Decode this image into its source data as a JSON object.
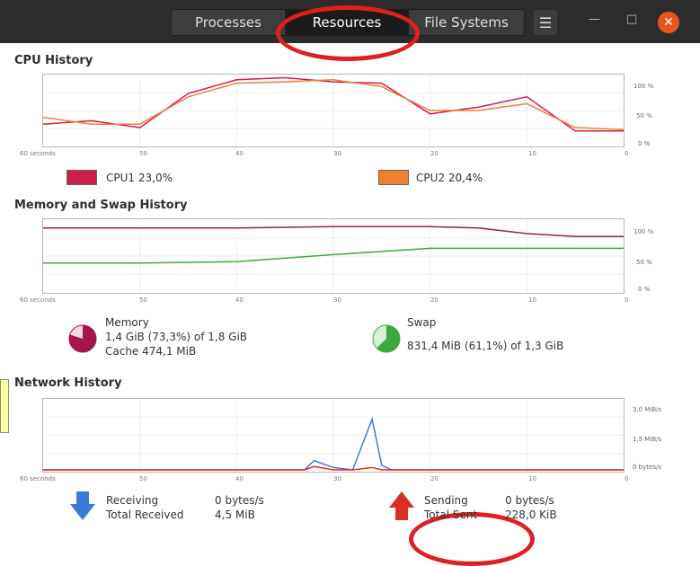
{
  "window": {
    "tabs": [
      {
        "label": "Processes"
      },
      {
        "label": "Resources"
      },
      {
        "label": "File Systems"
      }
    ],
    "menu_icon": "hamburger-icon",
    "colors": {
      "close": "#e95420",
      "titlebar": "#2c2c2c"
    }
  },
  "cpu": {
    "title": "CPU History",
    "y_ticks": [
      "100 %",
      "50 %",
      "0 %"
    ],
    "x_ticks": [
      "60 seconds",
      "50",
      "40",
      "30",
      "20",
      "10",
      "0"
    ],
    "legend": [
      {
        "label": "CPU1",
        "value": "23,0%",
        "color": "#cc1f4a"
      },
      {
        "label": "CPU2",
        "value": "20,4%",
        "color": "#f08030"
      }
    ]
  },
  "memory": {
    "title": "Memory and Swap History",
    "y_ticks": [
      "100 %",
      "50 %",
      "0 %"
    ],
    "x_ticks": [
      "60 seconds",
      "50",
      "40",
      "30",
      "20",
      "10",
      "0"
    ],
    "memory_label": "Memory",
    "memory_value": "1,4 GiB (73,3%) of 1,8 GiB",
    "cache_value": "Cache 474,1 MiB",
    "memory_color": "#a4164c",
    "swap_label": "Swap",
    "swap_value": "831,4 MiB (61,1%) of 1,3 GiB",
    "swap_color": "#3ea83e"
  },
  "network": {
    "title": "Network History",
    "y_ticks": [
      "3,0 MiB/s",
      "1,5 MiB/s",
      "0 bytes/s"
    ],
    "x_ticks": [
      "60 seconds",
      "50",
      "40",
      "30",
      "20",
      "10",
      "0"
    ],
    "receiving_label": "Receiving",
    "receiving_value": "0 bytes/s",
    "total_received_label": "Total Received",
    "total_received_value": "4,5 MiB",
    "sending_label": "Sending",
    "sending_value": "0 bytes/s",
    "total_sent_label": "Total Sent",
    "total_sent_value": "228,0 KiB",
    "receiving_color": "#3a7bd5",
    "sending_color": "#d93025"
  },
  "chart_data": [
    {
      "type": "line",
      "title": "CPU History",
      "x": [
        60,
        55,
        50,
        45,
        40,
        35,
        30,
        25,
        20,
        15,
        10,
        5,
        0
      ],
      "ylim": [
        0,
        100
      ],
      "series": [
        {
          "name": "CPU1",
          "values": [
            30,
            35,
            25,
            75,
            95,
            98,
            92,
            90,
            45,
            55,
            70,
            20,
            20
          ]
        },
        {
          "name": "CPU2",
          "values": [
            40,
            30,
            30,
            70,
            90,
            92,
            95,
            85,
            50,
            50,
            60,
            25,
            22
          ]
        }
      ]
    },
    {
      "type": "line",
      "title": "Memory and Swap History",
      "x": [
        60,
        50,
        40,
        30,
        20,
        15,
        10,
        5,
        0
      ],
      "ylim": [
        0,
        100
      ],
      "series": [
        {
          "values": [
            90,
            90,
            90,
            92,
            92,
            90,
            82,
            78,
            78
          ]
        },
        {
          "values": [
            40,
            40,
            42,
            52,
            61,
            61,
            61,
            61,
            61
          ]
        }
      ]
    },
    {
      "type": "line",
      "title": "Network History",
      "x": [
        60,
        40,
        33,
        32,
        30,
        28,
        26,
        25,
        24,
        22,
        0
      ],
      "ylim": [
        0,
        3.0
      ],
      "series": [
        {
          "values": [
            0,
            0,
            0,
            0.4,
            0.1,
            0,
            2.2,
            0.2,
            0,
            0,
            0
          ]
        },
        {
          "values": [
            0,
            0,
            0,
            0.15,
            0,
            0,
            0.1,
            0,
            0,
            0,
            0
          ]
        }
      ]
    }
  ]
}
